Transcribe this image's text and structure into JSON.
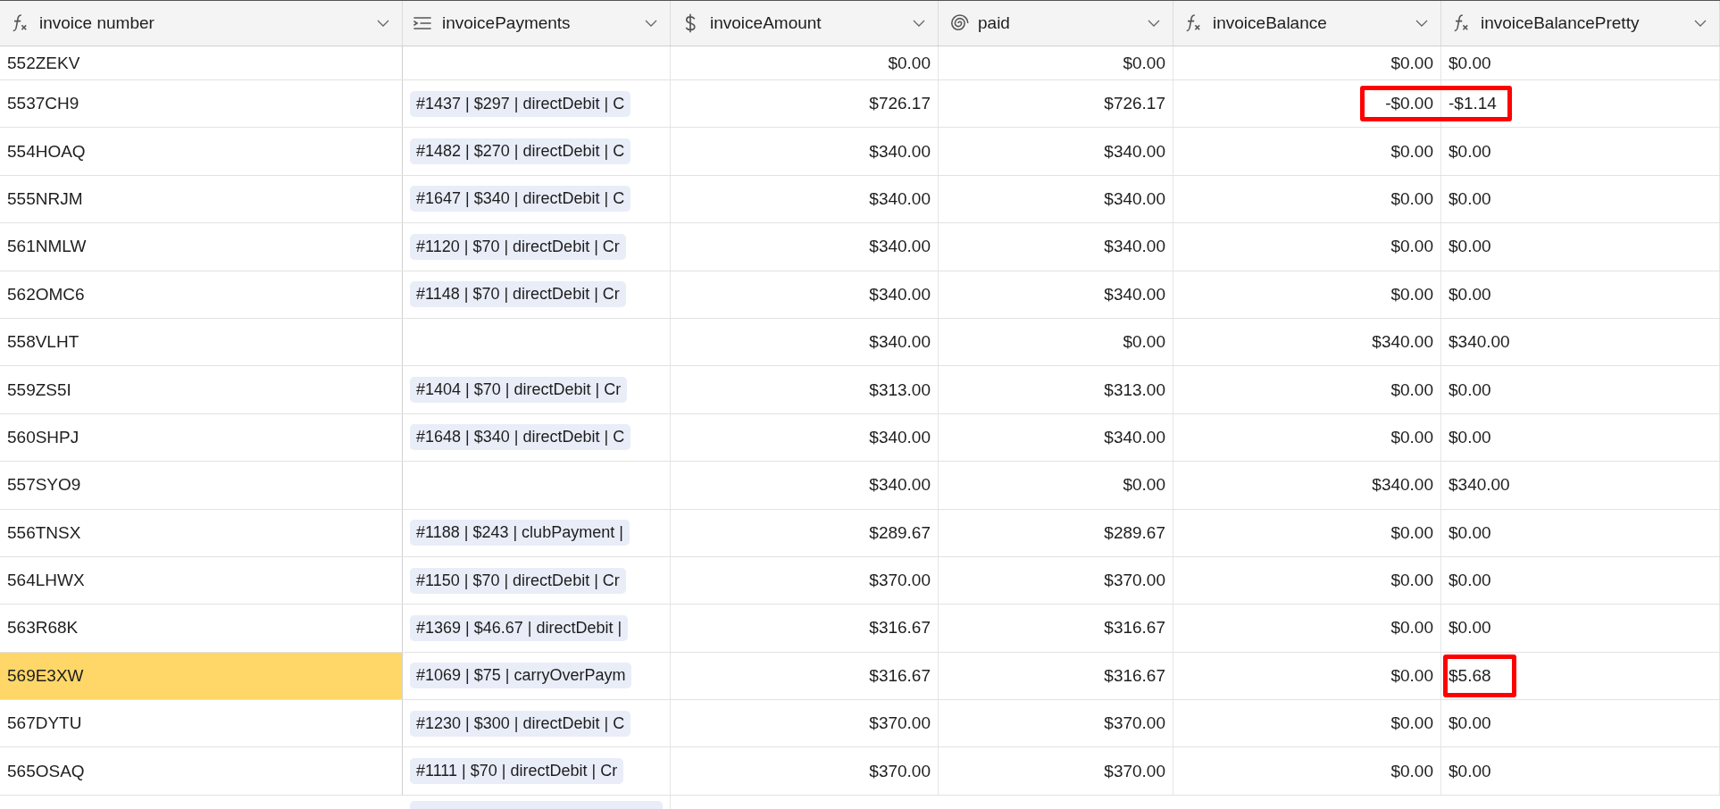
{
  "columns": [
    {
      "label": "invoice number",
      "kind": "formula"
    },
    {
      "label": "invoicePayments",
      "kind": "link"
    },
    {
      "label": "invoiceAmount",
      "kind": "currency"
    },
    {
      "label": "paid",
      "kind": "rollup"
    },
    {
      "label": "invoiceBalance",
      "kind": "formula"
    },
    {
      "label": "invoiceBalancePretty",
      "kind": "formula"
    }
  ],
  "rows": [
    {
      "invoice": "552ZEKV",
      "payment": "",
      "amount": "$0.00",
      "paid": "$0.00",
      "balance": "$0.00",
      "pretty": "$0.00",
      "selected": false,
      "balance_flagged": false,
      "pretty_flagged": false
    },
    {
      "invoice": "5537CH9",
      "payment": "#1437 | $297 | directDebit | C",
      "amount": "$726.17",
      "paid": "$726.17",
      "balance": "-$0.00",
      "pretty": "-$1.14",
      "selected": false,
      "balance_flagged": true,
      "pretty_flagged": true
    },
    {
      "invoice": "554HOAQ",
      "payment": "#1482 | $270 | directDebit | C",
      "amount": "$340.00",
      "paid": "$340.00",
      "balance": "$0.00",
      "pretty": "$0.00",
      "selected": false,
      "balance_flagged": false,
      "pretty_flagged": false
    },
    {
      "invoice": "555NRJM",
      "payment": "#1647 | $340 | directDebit | C",
      "amount": "$340.00",
      "paid": "$340.00",
      "balance": "$0.00",
      "pretty": "$0.00",
      "selected": false,
      "balance_flagged": false,
      "pretty_flagged": false
    },
    {
      "invoice": "561NMLW",
      "payment": "#1120 | $70 | directDebit | Cr",
      "amount": "$340.00",
      "paid": "$340.00",
      "balance": "$0.00",
      "pretty": "$0.00",
      "selected": false,
      "balance_flagged": false,
      "pretty_flagged": false
    },
    {
      "invoice": "562OMC6",
      "payment": "#1148 | $70 | directDebit | Cr",
      "amount": "$340.00",
      "paid": "$340.00",
      "balance": "$0.00",
      "pretty": "$0.00",
      "selected": false,
      "balance_flagged": false,
      "pretty_flagged": false
    },
    {
      "invoice": "558VLHT",
      "payment": "",
      "amount": "$340.00",
      "paid": "$0.00",
      "balance": "$340.00",
      "pretty": "$340.00",
      "selected": false,
      "balance_flagged": false,
      "pretty_flagged": false
    },
    {
      "invoice": "559ZS5I",
      "payment": "#1404 | $70 | directDebit | Cr",
      "amount": "$313.00",
      "paid": "$313.00",
      "balance": "$0.00",
      "pretty": "$0.00",
      "selected": false,
      "balance_flagged": false,
      "pretty_flagged": false
    },
    {
      "invoice": "560SHPJ",
      "payment": "#1648 | $340 | directDebit | C",
      "amount": "$340.00",
      "paid": "$340.00",
      "balance": "$0.00",
      "pretty": "$0.00",
      "selected": false,
      "balance_flagged": false,
      "pretty_flagged": false
    },
    {
      "invoice": "557SYO9",
      "payment": "",
      "amount": "$340.00",
      "paid": "$0.00",
      "balance": "$340.00",
      "pretty": "$340.00",
      "selected": false,
      "balance_flagged": false,
      "pretty_flagged": false
    },
    {
      "invoice": "556TNSX",
      "payment": "#1188 | $243 | clubPayment |",
      "amount": "$289.67",
      "paid": "$289.67",
      "balance": "$0.00",
      "pretty": "$0.00",
      "selected": false,
      "balance_flagged": false,
      "pretty_flagged": false
    },
    {
      "invoice": "564LHWX",
      "payment": "#1150 | $70 | directDebit | Cr",
      "amount": "$370.00",
      "paid": "$370.00",
      "balance": "$0.00",
      "pretty": "$0.00",
      "selected": false,
      "balance_flagged": false,
      "pretty_flagged": false
    },
    {
      "invoice": "563R68K",
      "payment": "#1369 | $46.67 | directDebit |",
      "amount": "$316.67",
      "paid": "$316.67",
      "balance": "$0.00",
      "pretty": "$0.00",
      "selected": false,
      "balance_flagged": false,
      "pretty_flagged": false
    },
    {
      "invoice": "569E3XW",
      "payment": "#1069 | $75 | carryOverPaym",
      "amount": "$316.67",
      "paid": "$316.67",
      "balance": "$0.00",
      "pretty": "$5.68",
      "selected": true,
      "balance_flagged": false,
      "pretty_flagged": true
    },
    {
      "invoice": "567DYTU",
      "payment": "#1230 | $300 | directDebit | C",
      "amount": "$370.00",
      "paid": "$370.00",
      "balance": "$0.00",
      "pretty": "$0.00",
      "selected": false,
      "balance_flagged": false,
      "pretty_flagged": false
    },
    {
      "invoice": "565OSAQ",
      "payment": "#1111 | $70 | directDebit | Cr",
      "amount": "$370.00",
      "paid": "$370.00",
      "balance": "$0.00",
      "pretty": "$0.00",
      "selected": false,
      "balance_flagged": false,
      "pretty_flagged": false
    }
  ]
}
